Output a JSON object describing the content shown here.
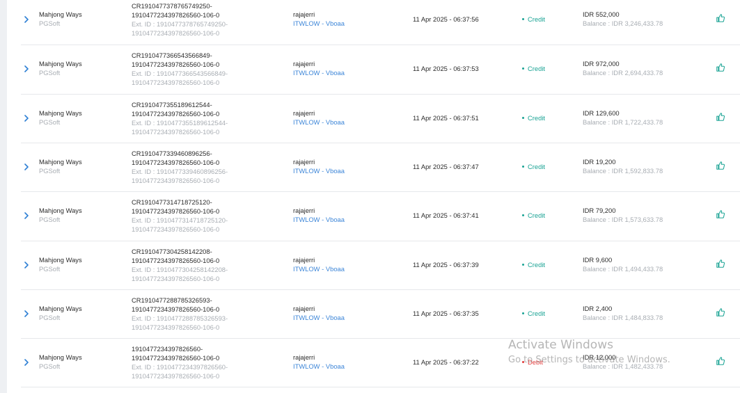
{
  "rows": [
    {
      "game": "Mahjong Ways",
      "provider": "PGSoft",
      "tx_line1": "CR1910477378765749250-",
      "tx_line2": "1910477234397826560-106-0",
      "ext_line1": "Ext. ID : 1910477378765749250-",
      "ext_line2": "1910477234397826560-106-0",
      "user": "rajajerri",
      "agent": "ITWLOW - Vboaa",
      "datetime": "11 Apr 2025 - 06:37:56",
      "status": "Credit",
      "amount": "IDR 552,000",
      "balance": "Balance : IDR 3,246,433.78"
    },
    {
      "game": "Mahjong Ways",
      "provider": "PGSoft",
      "tx_line1": "CR1910477366543566849-",
      "tx_line2": "1910477234397826560-106-0",
      "ext_line1": "Ext. ID : 1910477366543566849-",
      "ext_line2": "1910477234397826560-106-0",
      "user": "rajajerri",
      "agent": "ITWLOW - Vboaa",
      "datetime": "11 Apr 2025 - 06:37:53",
      "status": "Credit",
      "amount": "IDR 972,000",
      "balance": "Balance : IDR 2,694,433.78"
    },
    {
      "game": "Mahjong Ways",
      "provider": "PGSoft",
      "tx_line1": "CR1910477355189612544-",
      "tx_line2": "1910477234397826560-106-0",
      "ext_line1": "Ext. ID : 1910477355189612544-",
      "ext_line2": "1910477234397826560-106-0",
      "user": "rajajerri",
      "agent": "ITWLOW - Vboaa",
      "datetime": "11 Apr 2025 - 06:37:51",
      "status": "Credit",
      "amount": "IDR 129,600",
      "balance": "Balance : IDR 1,722,433.78"
    },
    {
      "game": "Mahjong Ways",
      "provider": "PGSoft",
      "tx_line1": "CR1910477339460896256-",
      "tx_line2": "1910477234397826560-106-0",
      "ext_line1": "Ext. ID : 1910477339460896256-",
      "ext_line2": "1910477234397826560-106-0",
      "user": "rajajerri",
      "agent": "ITWLOW - Vboaa",
      "datetime": "11 Apr 2025 - 06:37:47",
      "status": "Credit",
      "amount": "IDR 19,200",
      "balance": "Balance : IDR 1,592,833.78"
    },
    {
      "game": "Mahjong Ways",
      "provider": "PGSoft",
      "tx_line1": "CR1910477314718725120-",
      "tx_line2": "1910477234397826560-106-0",
      "ext_line1": "Ext. ID : 1910477314718725120-",
      "ext_line2": "1910477234397826560-106-0",
      "user": "rajajerri",
      "agent": "ITWLOW - Vboaa",
      "datetime": "11 Apr 2025 - 06:37:41",
      "status": "Credit",
      "amount": "IDR 79,200",
      "balance": "Balance : IDR 1,573,633.78"
    },
    {
      "game": "Mahjong Ways",
      "provider": "PGSoft",
      "tx_line1": "CR1910477304258142208-",
      "tx_line2": "1910477234397826560-106-0",
      "ext_line1": "Ext. ID : 1910477304258142208-",
      "ext_line2": "1910477234397826560-106-0",
      "user": "rajajerri",
      "agent": "ITWLOW - Vboaa",
      "datetime": "11 Apr 2025 - 06:37:39",
      "status": "Credit",
      "amount": "IDR 9,600",
      "balance": "Balance : IDR 1,494,433.78"
    },
    {
      "game": "Mahjong Ways",
      "provider": "PGSoft",
      "tx_line1": "CR1910477288785326593-",
      "tx_line2": "1910477234397826560-106-0",
      "ext_line1": "Ext. ID : 1910477288785326593-",
      "ext_line2": "1910477234397826560-106-0",
      "user": "rajajerri",
      "agent": "ITWLOW - Vboaa",
      "datetime": "11 Apr 2025 - 06:37:35",
      "status": "Credit",
      "amount": "IDR 2,400",
      "balance": "Balance : IDR 1,484,833.78"
    },
    {
      "game": "Mahjong Ways",
      "provider": "PGSoft",
      "tx_line1": "1910477234397826560-",
      "tx_line2": "1910477234397826560-106-0",
      "ext_line1": "Ext. ID : 1910477234397826560-",
      "ext_line2": "1910477234397826560-106-0",
      "user": "rajajerri",
      "agent": "ITWLOW - Vboaa",
      "datetime": "11 Apr 2025 - 06:37:22",
      "status": "Debit",
      "amount": "IDR 12,000",
      "balance": "Balance : IDR 1,482,433.78"
    }
  ],
  "colors": {
    "credit": "#1aa394",
    "debit": "#e23b3b",
    "link": "#3d86d8",
    "muted": "#a8adb3",
    "accent": "#1aa394"
  },
  "watermark": {
    "line1": "Activate Windows",
    "line2": "Go to Settings to activate Windows."
  }
}
